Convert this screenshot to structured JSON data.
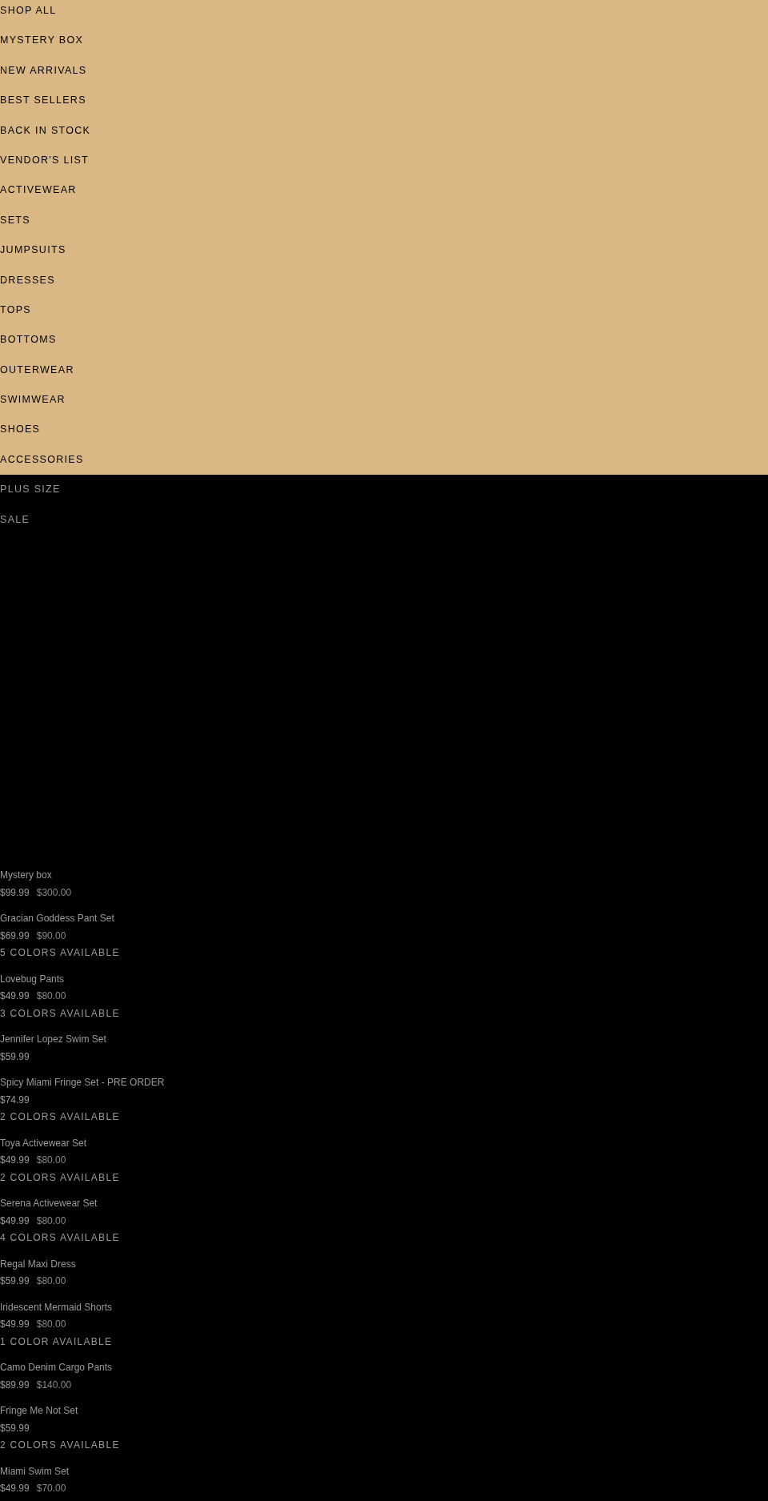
{
  "menu": [
    {
      "label": "SHOP ALL"
    },
    {
      "label": "MYSTERY BOX"
    },
    {
      "label": "NEW ARRIVALS"
    },
    {
      "label": "BEST SELLERS"
    },
    {
      "label": "BACK IN STOCK"
    },
    {
      "label": "VENDOR'S LIST"
    },
    {
      "label": "ACTIVEWEAR"
    },
    {
      "label": "SETS"
    },
    {
      "label": "JUMPSUITS"
    },
    {
      "label": "DRESSES"
    },
    {
      "label": "TOPS"
    },
    {
      "label": "BOTTOMS"
    },
    {
      "label": "OUTERWEAR"
    },
    {
      "label": "SWIMWEAR"
    },
    {
      "label": "SHOES"
    },
    {
      "label": "ACCESSORIES"
    },
    {
      "label": "PLUS SIZE"
    },
    {
      "label": "SALE"
    }
  ],
  "products": [
    {
      "title": "Mystery box",
      "price": "$99.99",
      "compare_price": "$300.00"
    },
    {
      "title": "Gracian Goddess Pant Set",
      "price": "$69.99",
      "compare_price": "$90.00",
      "colors": "5 COLORS AVAILABLE"
    },
    {
      "title": "Lovebug Pants",
      "price": "$49.99",
      "compare_price": "$80.00",
      "colors": "3 COLORS AVAILABLE"
    },
    {
      "title": "Jennifer Lopez Swim Set",
      "price": "$59.99"
    },
    {
      "title": "Spicy Miami Fringe Set - PRE ORDER",
      "price": "$74.99",
      "colors": "2 COLORS AVAILABLE"
    },
    {
      "title": "Toya Activewear Set",
      "price": "$49.99",
      "compare_price": "$80.00",
      "colors": "2 COLORS AVAILABLE"
    },
    {
      "title": "Serena Activewear Set",
      "price": "$49.99",
      "compare_price": "$80.00",
      "colors": "4 COLORS AVAILABLE"
    },
    {
      "title": "Regal Maxi Dress",
      "price": "$59.99",
      "compare_price": "$80.00"
    },
    {
      "title": "Iridescent Mermaid Shorts",
      "price": "$49.99",
      "compare_price": "$80.00",
      "colors": "1 COLOR AVAILABLE"
    },
    {
      "title": "Camo Denim Cargo Pants",
      "price": "$89.99",
      "compare_price": "$140.00"
    },
    {
      "title": "Fringe Me Not Set",
      "price": "$59.99",
      "colors": "2 COLORS AVAILABLE"
    },
    {
      "title": "Miami Swim Set",
      "price": "$49.99",
      "compare_price": "$70.00"
    }
  ]
}
